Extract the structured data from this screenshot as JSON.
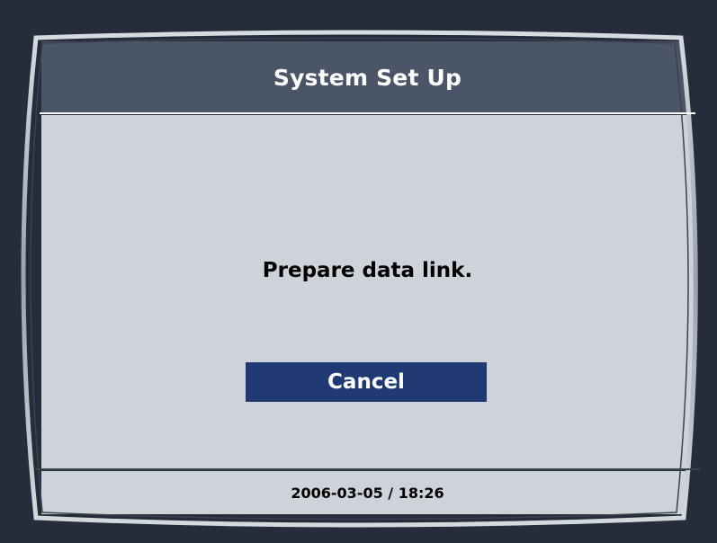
{
  "window": {
    "title": "System Set Up"
  },
  "dialog": {
    "message": "Prepare data link.",
    "cancel_label": "Cancel"
  },
  "footer": {
    "datetime": "2006-03-05 / 18:26"
  },
  "colors": {
    "background": "#252d3d",
    "title_bar": "#4a5568",
    "panel": "#ced2d9",
    "button": "#1f3a72",
    "text_light": "#ffffff",
    "text_dark": "#000000"
  }
}
